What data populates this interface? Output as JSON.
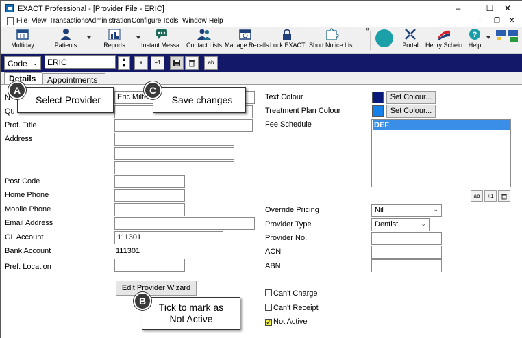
{
  "window": {
    "title": "EXACT Professional - [Provider File - ERIC]",
    "minimize": "–",
    "maximize": "☐",
    "close": "✕"
  },
  "menu": [
    "File",
    "View",
    "Transactions",
    "Administration",
    "Configure",
    "Tools",
    "Window",
    "Help"
  ],
  "mdi_controls": {
    "minimize": "–",
    "restore": "❐",
    "close": "✕"
  },
  "toolbar": {
    "multiday": "Multiday",
    "patients": "Patients",
    "reports": "Reports",
    "instant_messages": "Instant Messa...",
    "contact_lists": "Contact Lists",
    "manage_recalls": "Manage Recalls",
    "lock_exact": "Lock EXACT",
    "short_notice_list": "Short Notice List",
    "overflow": "»",
    "portal": "Portal",
    "henry_schein": "Henry Schein",
    "help": "Help"
  },
  "navbar": {
    "code_select": "Code",
    "provider_value": "ERIC",
    "edit_btn": "≡",
    "plus_one": "+1",
    "abc_btn": "ab"
  },
  "tabs": {
    "details": "Details",
    "appointments": "Appointments"
  },
  "form_left": {
    "name_label": "N",
    "name_value": "Eric Milte",
    "qual_label": "Qu",
    "prof_title": "Prof. Title",
    "address": "Address",
    "post_code": "Post Code",
    "home_phone": "Home Phone",
    "mobile_phone": "Mobile Phone",
    "email_address": "Email Address",
    "gl_account": "GL Account",
    "gl_account_value": "111301",
    "bank_account": "Bank Account",
    "bank_account_value": "111301",
    "pref_location": "Pref. Location",
    "edit_wizard": "Edit Provider Wizard"
  },
  "form_right": {
    "text_colour": "Text Colour",
    "text_colour_hex": "#0a1a7a",
    "treatment_plan_colour": "Treatment Plan Colour",
    "treatment_plan_colour_hex": "#1480e8",
    "set_colour": "Set Colour...",
    "fee_schedule": "Fee Schedule",
    "fee_schedule_selected": "DEF",
    "override_pricing": "Override Pricing",
    "override_pricing_value": "Nil",
    "provider_type": "Provider Type",
    "provider_type_value": "Dentist",
    "provider_no": "Provider No.",
    "acn": "ACN",
    "abn": "ABN",
    "cant_charge": "Can't Charge",
    "cant_receipt": "Can't Receipt",
    "not_active": "Not Active",
    "not_active_checked": "✓"
  },
  "callouts": {
    "a_letter": "A",
    "a_text": "Select Provider",
    "b_letter": "B",
    "b_text_line1": "Tick to mark as",
    "b_text_line2": "Not Active",
    "c_letter": "C",
    "c_text": "Save changes"
  }
}
